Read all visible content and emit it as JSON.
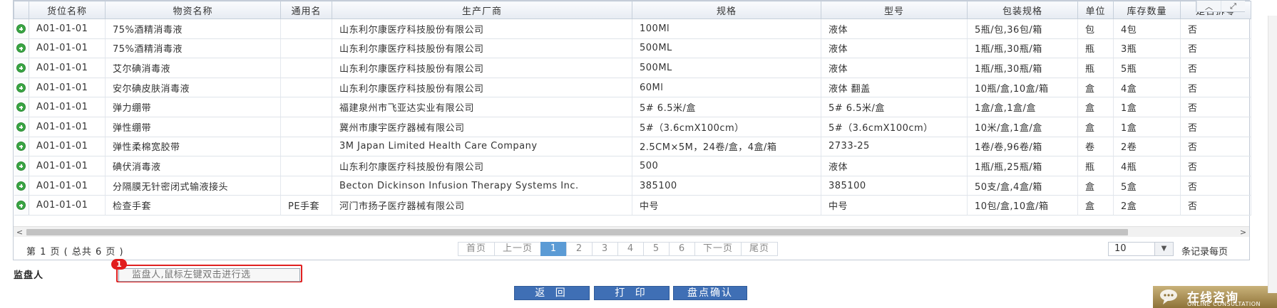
{
  "grid": {
    "columns": [
      "货位名称",
      "物资名称",
      "通用名",
      "生产厂商",
      "规格",
      "型号",
      "包装规格",
      "单位",
      "库存数量",
      "是否拆零"
    ],
    "rows": [
      [
        "A01-01-01",
        "75%酒精消毒液",
        "",
        "山东利尔康医疗科技股份有限公司",
        "100Ml",
        "液体",
        "5瓶/包,36包/箱",
        "包",
        "4包",
        "否"
      ],
      [
        "A01-01-01",
        "75%酒精消毒液",
        "",
        "山东利尔康医疗科技股份有限公司",
        "500ML",
        "液体",
        "1瓶/瓶,30瓶/箱",
        "瓶",
        "3瓶",
        "否"
      ],
      [
        "A01-01-01",
        "艾尔碘消毒液",
        "",
        "山东利尔康医疗科技股份有限公司",
        "500ML",
        "液体",
        "1瓶/瓶,30瓶/箱",
        "瓶",
        "5瓶",
        "否"
      ],
      [
        "A01-01-01",
        "安尔碘皮肤消毒液",
        "",
        "山东利尔康医疗科技股份有限公司",
        "60Ml",
        "液体 翻盖",
        "10瓶/盒,10盒/箱",
        "盒",
        "4盒",
        "否"
      ],
      [
        "A01-01-01",
        "弹力绷带",
        "",
        "福建泉州市飞亚达实业有限公司",
        "5# 6.5米/盒",
        "5# 6.5米/盒",
        "1盒/盒,1盒/盒",
        "盒",
        "1盒",
        "否"
      ],
      [
        "A01-01-01",
        "弹性绷带",
        "",
        "冀州市康宇医疗器械有限公司",
        "5#（3.6cmX100cm）",
        "5#（3.6cmX100cm）",
        "10米/盒,1盒/盒",
        "盒",
        "1盒",
        "否"
      ],
      [
        "A01-01-01",
        "弹性柔棉宽胶带",
        "",
        "3M Japan Limited Health Care Company",
        "2.5CM×5M，24卷/盒，4盒/箱",
        "2733-25",
        "1卷/卷,96卷/箱",
        "卷",
        "2卷",
        "否"
      ],
      [
        "A01-01-01",
        "碘伏消毒液",
        "",
        "山东利尔康医疗科技股份有限公司",
        "500",
        "液体",
        "1瓶/瓶,25瓶/箱",
        "瓶",
        "4瓶",
        "否"
      ],
      [
        "A01-01-01",
        "分隔膜无针密闭式输液接头",
        "",
        "Becton Dickinson Infusion Therapy Systems Inc.",
        "385100",
        "385100",
        "50支/盒,4盒/箱",
        "盒",
        "5盒",
        "否"
      ],
      [
        "A01-01-01",
        "检查手套",
        "PE手套",
        "河门市扬子医疗器械有限公司",
        "中号",
        "中号",
        "10包/盒,10盒/箱",
        "盒",
        "2盒",
        "否"
      ]
    ]
  },
  "pager": {
    "info": "第 1 页 ( 总共 6 页 )",
    "first": "首页",
    "prev": "上一页",
    "pages": [
      "1",
      "2",
      "3",
      "4",
      "5",
      "6"
    ],
    "current": "1",
    "next": "下一页",
    "last": "尾页",
    "page_size": "10",
    "page_size_label": "条记录每页"
  },
  "monitor": {
    "label": "监盘人",
    "placeholder": "监盘人,鼠标左键双击进行选",
    "badge": "1"
  },
  "actions": {
    "back": "返 回",
    "print": "打 印",
    "confirm": "盘点确认"
  },
  "consult": {
    "title": "在线咨询",
    "subtitle": "ONLINE CONSULTATION"
  },
  "colors": {
    "accent": "#3f6fb5",
    "active_page": "#5b9bd5",
    "highlight_border": "#e02020",
    "expand_icon": "#3aa544"
  }
}
